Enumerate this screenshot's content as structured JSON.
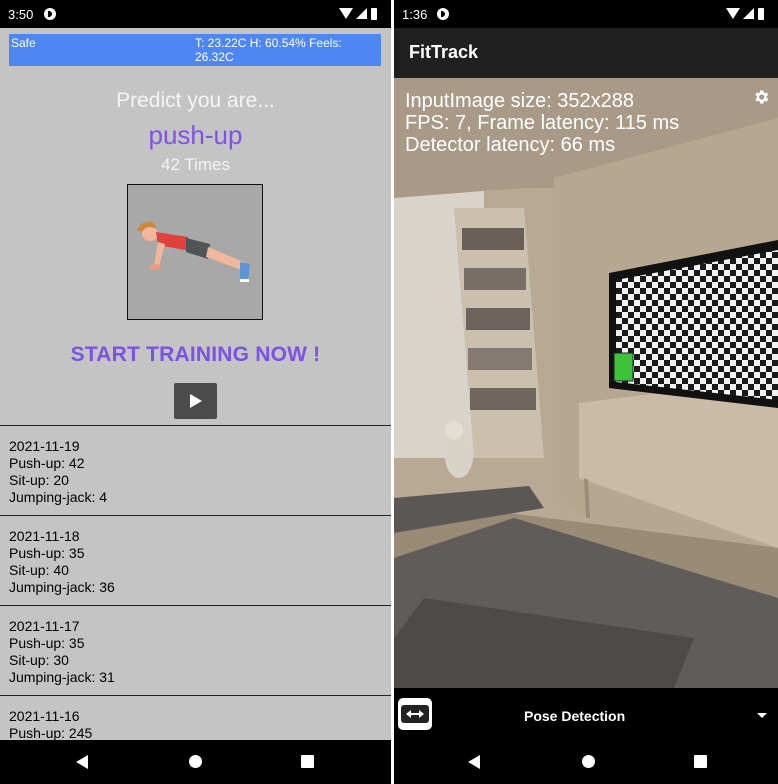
{
  "left_phone": {
    "status_time": "3:50",
    "weather": {
      "safe_label": "Safe",
      "temperature_text": "T: 23.22C H: 60.54% Feels: 26.32C"
    },
    "predict_label": "Predict you are...",
    "exercise": "push-up",
    "count_text": "42 Times",
    "exercise_image_icon": "push-up-illustration-icon",
    "start_training_label": "START TRAINING NOW !",
    "play_icon": "play-icon",
    "history": [
      {
        "date": "2021-11-19",
        "pushup": "Push-up: 42",
        "situp": "Sit-up: 20",
        "jumpingjack": "Jumping-jack: 4"
      },
      {
        "date": "2021-11-18",
        "pushup": "Push-up: 35",
        "situp": "Sit-up: 40",
        "jumpingjack": "Jumping-jack: 36"
      },
      {
        "date": "2021-11-17",
        "pushup": "Push-up: 35",
        "situp": "Sit-up: 30",
        "jumpingjack": "Jumping-jack: 31"
      },
      {
        "date": "2021-11-16",
        "pushup": "Push-up: 245"
      }
    ],
    "colors": {
      "background": "#c4c4c4",
      "weather_bar": "#4f87f2",
      "accent": "#8151e8"
    }
  },
  "right_phone": {
    "status_time": "1:36",
    "app_title": "FitTrack",
    "overlay": {
      "line1": "InputImage size: 352x288",
      "line2": "FPS: 7, Frame latency: 115 ms",
      "line3": "Detector latency: 66 ms"
    },
    "settings_icon": "gear-icon",
    "switch_camera_icon": "switch-camera-icon",
    "mode_selected": "Pose Detection",
    "colors": {
      "appbar": "#202020",
      "detection_box": "#3ec23a"
    }
  }
}
